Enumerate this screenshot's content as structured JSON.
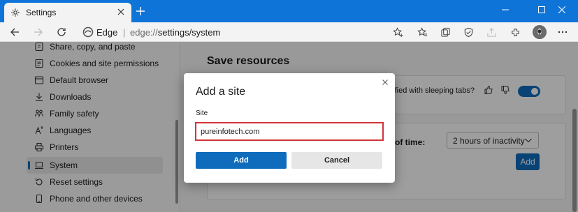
{
  "window": {
    "tab_title": "Settings",
    "tab_icon": "gear-icon",
    "controls": [
      "minimize-icon",
      "maximize-icon",
      "close-icon"
    ]
  },
  "toolbar": {
    "site_name": "Edge",
    "separator": "|",
    "url_prefix": "edge://",
    "url_path": "settings/system",
    "icons": [
      "back-arrow-icon",
      "forward-arrow-icon",
      "refresh-icon",
      "favorite-add-icon",
      "favorites-icon",
      "collections-icon",
      "shield-icon",
      "share-icon",
      "extensions-icon",
      "profile-icon",
      "more-icon"
    ]
  },
  "sidebar": {
    "items": [
      {
        "label": "Share, copy, and paste",
        "icon": "share-icon"
      },
      {
        "label": "Cookies and site permissions",
        "icon": "cookie-icon"
      },
      {
        "label": "Default browser",
        "icon": "browser-icon"
      },
      {
        "label": "Downloads",
        "icon": "download-icon"
      },
      {
        "label": "Family safety",
        "icon": "family-icon"
      },
      {
        "label": "Languages",
        "icon": "language-icon"
      },
      {
        "label": "Printers",
        "icon": "printer-icon"
      },
      {
        "label": "System",
        "icon": "laptop-icon",
        "active": true
      },
      {
        "label": "Reset settings",
        "icon": "reset-icon"
      },
      {
        "label": "Phone and other devices",
        "icon": "phone-icon"
      }
    ]
  },
  "main": {
    "section_title": "Save resources",
    "feedback_text": "satisfied with sleeping tabs?",
    "sleeping_tabs_enabled": true,
    "time_label": "of time:",
    "time_value": "2 hours of inactivity",
    "add_label": "Add"
  },
  "dialog": {
    "title": "Add a site",
    "field_label": "Site",
    "field_value": "pureinfotech.com",
    "add_label": "Add",
    "cancel_label": "Cancel"
  },
  "colors": {
    "titlebar": "#0f74d8",
    "accent": "#0f6cbd",
    "input_highlight": "#d13438"
  }
}
